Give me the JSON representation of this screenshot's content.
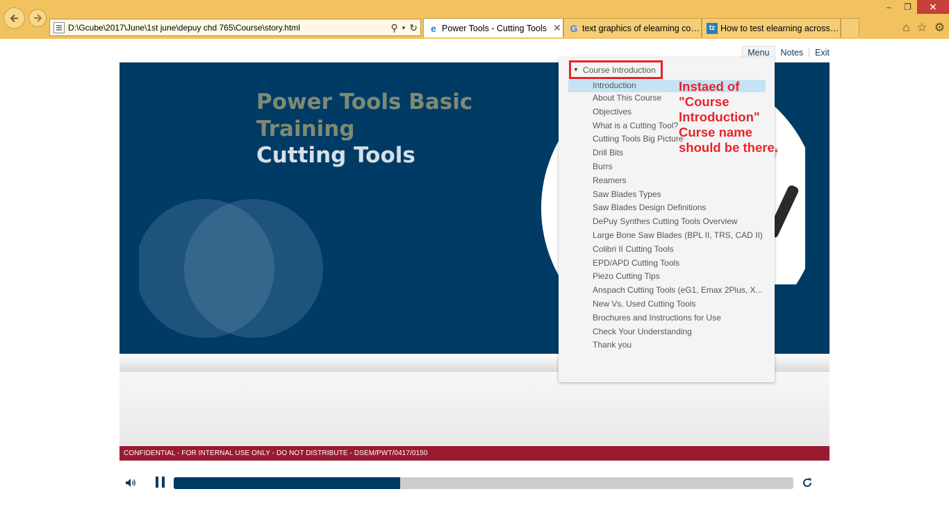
{
  "browser": {
    "address": "D:\\Gcube\\2017\\June\\1st june\\depuy chd 765\\Course\\story.html",
    "tabs": [
      {
        "label": "Power Tools - Cutting Tools",
        "icon": "ie-icon",
        "active": true
      },
      {
        "label": "text graphics of elearning cour...",
        "icon": "google-icon",
        "active": false
      },
      {
        "label": "How to test elearning across m...",
        "icon": "tz-icon",
        "active": false
      }
    ],
    "tab_close": "✕",
    "window_controls": [
      "–",
      "❐",
      "✕"
    ]
  },
  "player": {
    "menu_label": "Menu",
    "notes_label": "Notes",
    "exit_label": "Exit"
  },
  "slide": {
    "title": "Power Tools Basic Training",
    "subtitle": "Cutting Tools"
  },
  "menu": {
    "section": "Course Introduction",
    "items": [
      "Introduction",
      "About This Course",
      "Objectives",
      "What is a Cutting Tool?",
      "Cutting Tools Big Picture",
      "Drill Bits",
      "Burrs",
      "Reamers",
      "Saw Blades Types",
      "Saw Blades Design Definitions",
      "DePuy Synthes Cutting Tools Overview",
      "Large Bone Saw Blades (BPL II, TRS, CAD II)",
      "Colibri II Cutting Tools",
      "EPD/APD Cutting Tools",
      "Piezo Cutting Tips",
      "Anspach Cutting Tools (eG1, Emax 2Plus, X...",
      "New Vs. Used Cutting Tools",
      "Brochures and Instructions for Use",
      "Check Your Understanding",
      "Thank you"
    ],
    "active_index": 0
  },
  "annotation": "Instaed of \"Course Introduction\" Curse name should be there.",
  "footer": {
    "confidential": "CONFIDENTIAL - FOR INTERNAL USE ONLY - DO NOT DISTRIBUTE - DSEM/PWT/0417/0150",
    "progress_fraction": 0.366
  },
  "colors": {
    "chrome": "#f2c25f",
    "slide_blue": "#003b65",
    "annotation_red": "#e8232a",
    "footer_red": "#9a1b30",
    "menu_highlight": "#c6e3f3"
  }
}
